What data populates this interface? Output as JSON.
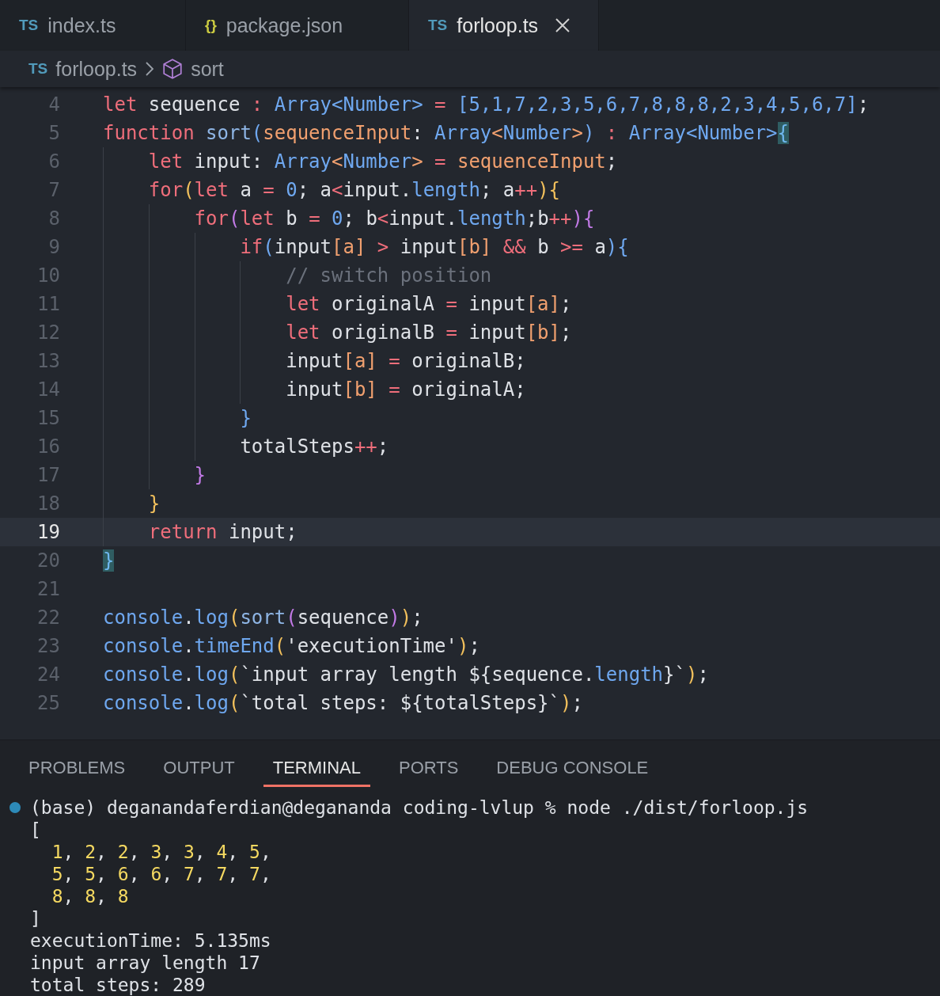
{
  "tabs": [
    {
      "icon_text": "TS",
      "color": "#519aba",
      "label": "index.ts",
      "selected": false
    },
    {
      "icon_text": "{}",
      "color": "#cbcb41",
      "label": "package.json",
      "selected": false
    },
    {
      "icon_text": "TS",
      "color": "#519aba",
      "label": "forloop.ts",
      "selected": true
    }
  ],
  "breadcrumb": {
    "file_icon_text": "TS",
    "file": "forloop.ts",
    "symbol": "sort"
  },
  "editor": {
    "lines": [
      {
        "number": "4",
        "current": false,
        "tokens": [
          {
            "text": "let",
            "kind": "keyword"
          },
          {
            "text": " sequence ",
            "kind": "plain"
          },
          {
            "text": ": ",
            "kind": "operator"
          },
          {
            "text": "Array<Number>",
            "kind": "type"
          },
          {
            "text": " = ",
            "kind": "operator"
          },
          {
            "text": "[5,1,7,2,3,5,6,7,8,8,8,2,3,4,5,6,7]",
            "kind": "number"
          },
          {
            "text": ";",
            "kind": "plain"
          }
        ]
      },
      {
        "number": "5",
        "current": false,
        "tokens": [
          {
            "text": "function",
            "kind": "keyword"
          },
          {
            "text": " sort",
            "kind": "func"
          },
          {
            "text": "(",
            "kind": "bracket2"
          },
          {
            "text": "sequenceInput",
            "kind": "param"
          },
          {
            "text": ": ",
            "kind": "plain"
          },
          {
            "text": "Array",
            "kind": "type"
          },
          {
            "text": "<",
            "kind": "param"
          },
          {
            "text": "Number",
            "kind": "type"
          },
          {
            "text": ">",
            "kind": "param"
          },
          {
            "text": ")",
            "kind": "bracket2"
          },
          {
            "text": " : ",
            "kind": "operator"
          },
          {
            "text": "Array<Number>",
            "kind": "type"
          },
          {
            "text": "{",
            "kind": "match"
          }
        ]
      },
      {
        "number": "6",
        "current": false,
        "tokens": [
          {
            "text": "    let",
            "kind": "keyword"
          },
          {
            "text": " input: ",
            "kind": "plain"
          },
          {
            "text": "Array",
            "kind": "type"
          },
          {
            "text": "<",
            "kind": "param"
          },
          {
            "text": "Number",
            "kind": "type"
          },
          {
            "text": ">",
            "kind": "param"
          },
          {
            "text": " = ",
            "kind": "operator"
          },
          {
            "text": "sequenceInput",
            "kind": "param"
          },
          {
            "text": ";",
            "kind": "plain"
          }
        ]
      },
      {
        "number": "7",
        "current": false,
        "tokens": [
          {
            "text": "    for",
            "kind": "keyword"
          },
          {
            "text": "(",
            "kind": "bracket1"
          },
          {
            "text": "let",
            "kind": "keyword"
          },
          {
            "text": " a ",
            "kind": "plain"
          },
          {
            "text": "= ",
            "kind": "operator"
          },
          {
            "text": "0",
            "kind": "number"
          },
          {
            "text": "; a",
            "kind": "plain"
          },
          {
            "text": "<",
            "kind": "operator"
          },
          {
            "text": "input.",
            "kind": "plain"
          },
          {
            "text": "length",
            "kind": "type"
          },
          {
            "text": "; a",
            "kind": "plain"
          },
          {
            "text": "++",
            "kind": "operator"
          },
          {
            "text": "){",
            "kind": "bracket1"
          }
        ]
      },
      {
        "number": "8",
        "current": false,
        "tokens": [
          {
            "text": "        for",
            "kind": "keyword"
          },
          {
            "text": "(",
            "kind": "bracket3"
          },
          {
            "text": "let",
            "kind": "keyword"
          },
          {
            "text": " b ",
            "kind": "plain"
          },
          {
            "text": "= ",
            "kind": "operator"
          },
          {
            "text": "0",
            "kind": "number"
          },
          {
            "text": "; b",
            "kind": "plain"
          },
          {
            "text": "<",
            "kind": "operator"
          },
          {
            "text": "input.",
            "kind": "plain"
          },
          {
            "text": "length",
            "kind": "type"
          },
          {
            "text": ";b",
            "kind": "plain"
          },
          {
            "text": "++",
            "kind": "operator"
          },
          {
            "text": "){",
            "kind": "bracket3"
          }
        ]
      },
      {
        "number": "9",
        "current": false,
        "tokens": [
          {
            "text": "            if",
            "kind": "keyword"
          },
          {
            "text": "(",
            "kind": "bracket2"
          },
          {
            "text": "input",
            "kind": "plain"
          },
          {
            "text": "[a]",
            "kind": "param"
          },
          {
            "text": " >",
            "kind": "operator"
          },
          {
            "text": " input",
            "kind": "plain"
          },
          {
            "text": "[b]",
            "kind": "param"
          },
          {
            "text": " &&",
            "kind": "operator"
          },
          {
            "text": " b ",
            "kind": "plain"
          },
          {
            "text": ">=",
            "kind": "operator"
          },
          {
            "text": " a",
            "kind": "plain"
          },
          {
            "text": "){",
            "kind": "bracket2"
          }
        ]
      },
      {
        "number": "10",
        "current": false,
        "tokens": [
          {
            "text": "                // switch position",
            "kind": "comment"
          }
        ]
      },
      {
        "number": "11",
        "current": false,
        "tokens": [
          {
            "text": "                let",
            "kind": "keyword"
          },
          {
            "text": " originalA ",
            "kind": "plain"
          },
          {
            "text": "=",
            "kind": "operator"
          },
          {
            "text": " input",
            "kind": "plain"
          },
          {
            "text": "[a]",
            "kind": "param"
          },
          {
            "text": ";",
            "kind": "plain"
          }
        ]
      },
      {
        "number": "12",
        "current": false,
        "tokens": [
          {
            "text": "                let",
            "kind": "keyword"
          },
          {
            "text": " originalB ",
            "kind": "plain"
          },
          {
            "text": "=",
            "kind": "operator"
          },
          {
            "text": " input",
            "kind": "plain"
          },
          {
            "text": "[b]",
            "kind": "param"
          },
          {
            "text": ";",
            "kind": "plain"
          }
        ]
      },
      {
        "number": "13",
        "current": false,
        "tokens": [
          {
            "text": "                input",
            "kind": "plain"
          },
          {
            "text": "[a]",
            "kind": "param"
          },
          {
            "text": " =",
            "kind": "operator"
          },
          {
            "text": " originalB;",
            "kind": "plain"
          }
        ]
      },
      {
        "number": "14",
        "current": false,
        "tokens": [
          {
            "text": "                input",
            "kind": "plain"
          },
          {
            "text": "[b]",
            "kind": "param"
          },
          {
            "text": " =",
            "kind": "operator"
          },
          {
            "text": " originalA;",
            "kind": "plain"
          }
        ]
      },
      {
        "number": "15",
        "current": false,
        "tokens": [
          {
            "text": "            }",
            "kind": "bracket2"
          }
        ]
      },
      {
        "number": "16",
        "current": false,
        "tokens": [
          {
            "text": "            totalSteps",
            "kind": "plain"
          },
          {
            "text": "++",
            "kind": "operator"
          },
          {
            "text": ";",
            "kind": "plain"
          }
        ]
      },
      {
        "number": "17",
        "current": false,
        "tokens": [
          {
            "text": "        }",
            "kind": "bracket3"
          }
        ]
      },
      {
        "number": "18",
        "current": false,
        "tokens": [
          {
            "text": "    }",
            "kind": "bracket1"
          }
        ]
      },
      {
        "number": "19",
        "current": true,
        "tokens": [
          {
            "text": "    return",
            "kind": "keyword"
          },
          {
            "text": " input;",
            "kind": "plain"
          }
        ]
      },
      {
        "number": "20",
        "current": false,
        "tokens": [
          {
            "text": "}",
            "kind": "match"
          }
        ]
      },
      {
        "number": "21",
        "current": false
      },
      {
        "number": "22",
        "current": false,
        "tokens": [
          {
            "text": "console",
            "kind": "type"
          },
          {
            "text": ".",
            "kind": "plain"
          },
          {
            "text": "log",
            "kind": "type"
          },
          {
            "text": "(",
            "kind": "bracket1"
          },
          {
            "text": "sort",
            "kind": "func"
          },
          {
            "text": "(",
            "kind": "bracket3"
          },
          {
            "text": "sequence",
            "kind": "plain"
          },
          {
            "text": ")",
            "kind": "bracket3"
          },
          {
            "text": ")",
            "kind": "bracket1"
          },
          {
            "text": ";",
            "kind": "plain"
          }
        ]
      },
      {
        "number": "23",
        "current": false,
        "tokens": [
          {
            "text": "console",
            "kind": "type"
          },
          {
            "text": ".",
            "kind": "plain"
          },
          {
            "text": "timeEnd",
            "kind": "type"
          },
          {
            "text": "(",
            "kind": "bracket1"
          },
          {
            "text": "'executionTime'",
            "kind": "plain"
          },
          {
            "text": ")",
            "kind": "bracket1"
          },
          {
            "text": ";",
            "kind": "plain"
          }
        ]
      },
      {
        "number": "24",
        "current": false,
        "tokens": [
          {
            "text": "console",
            "kind": "type"
          },
          {
            "text": ".",
            "kind": "plain"
          },
          {
            "text": "log",
            "kind": "type"
          },
          {
            "text": "(",
            "kind": "bracket1"
          },
          {
            "text": "`input array length ${sequence.",
            "kind": "plain"
          },
          {
            "text": "length",
            "kind": "type"
          },
          {
            "text": "}`",
            "kind": "plain"
          },
          {
            "text": ")",
            "kind": "bracket1"
          },
          {
            "text": ";",
            "kind": "plain"
          }
        ]
      },
      {
        "number": "25",
        "current": false,
        "tokens": [
          {
            "text": "console",
            "kind": "type"
          },
          {
            "text": ".",
            "kind": "plain"
          },
          {
            "text": "log",
            "kind": "type"
          },
          {
            "text": "(",
            "kind": "bracket1"
          },
          {
            "text": "`total steps: ${totalSteps}`",
            "kind": "plain"
          },
          {
            "text": ")",
            "kind": "bracket1"
          },
          {
            "text": ";",
            "kind": "plain"
          }
        ]
      }
    ]
  },
  "panel": {
    "tabs": [
      {
        "label": "PROBLEMS",
        "selected": false
      },
      {
        "label": "OUTPUT",
        "selected": false
      },
      {
        "label": "TERMINAL",
        "selected": true
      },
      {
        "label": "PORTS",
        "selected": false
      },
      {
        "label": "DEBUG CONSOLE",
        "selected": false
      }
    ],
    "terminal": [
      {
        "prompt": true,
        "tokens": [
          {
            "text": "(base) deganandaferdian@degananda coding-lvlup % node ./dist/forloop.js",
            "kind": "plain"
          }
        ]
      },
      {
        "prompt": false,
        "tokens": [
          {
            "text": "[",
            "kind": "plain"
          }
        ]
      },
      {
        "prompt": false,
        "tokens": [
          {
            "text": "  1",
            "kind": "number"
          },
          {
            "text": ", ",
            "kind": "plain"
          },
          {
            "text": "2",
            "kind": "number"
          },
          {
            "text": ", ",
            "kind": "plain"
          },
          {
            "text": "2",
            "kind": "number"
          },
          {
            "text": ", ",
            "kind": "plain"
          },
          {
            "text": "3",
            "kind": "number"
          },
          {
            "text": ", ",
            "kind": "plain"
          },
          {
            "text": "3",
            "kind": "number"
          },
          {
            "text": ", ",
            "kind": "plain"
          },
          {
            "text": "4",
            "kind": "number"
          },
          {
            "text": ", ",
            "kind": "plain"
          },
          {
            "text": "5",
            "kind": "number"
          },
          {
            "text": ",",
            "kind": "plain"
          }
        ]
      },
      {
        "prompt": false,
        "tokens": [
          {
            "text": "  5",
            "kind": "number"
          },
          {
            "text": ", ",
            "kind": "plain"
          },
          {
            "text": "5",
            "kind": "number"
          },
          {
            "text": ", ",
            "kind": "plain"
          },
          {
            "text": "6",
            "kind": "number"
          },
          {
            "text": ", ",
            "kind": "plain"
          },
          {
            "text": "6",
            "kind": "number"
          },
          {
            "text": ", ",
            "kind": "plain"
          },
          {
            "text": "7",
            "kind": "number"
          },
          {
            "text": ", ",
            "kind": "plain"
          },
          {
            "text": "7",
            "kind": "number"
          },
          {
            "text": ", ",
            "kind": "plain"
          },
          {
            "text": "7",
            "kind": "number"
          },
          {
            "text": ",",
            "kind": "plain"
          }
        ]
      },
      {
        "prompt": false,
        "tokens": [
          {
            "text": "  8",
            "kind": "number"
          },
          {
            "text": ", ",
            "kind": "plain"
          },
          {
            "text": "8",
            "kind": "number"
          },
          {
            "text": ", ",
            "kind": "plain"
          },
          {
            "text": "8",
            "kind": "number"
          }
        ]
      },
      {
        "prompt": false,
        "tokens": [
          {
            "text": "]",
            "kind": "plain"
          }
        ]
      },
      {
        "prompt": false,
        "tokens": [
          {
            "text": "executionTime: 5.135ms",
            "kind": "plain"
          }
        ]
      },
      {
        "prompt": false,
        "tokens": [
          {
            "text": "input array length 17",
            "kind": "plain"
          }
        ]
      },
      {
        "prompt": false,
        "tokens": [
          {
            "text": "total steps: 289",
            "kind": "plain"
          }
        ]
      }
    ]
  }
}
